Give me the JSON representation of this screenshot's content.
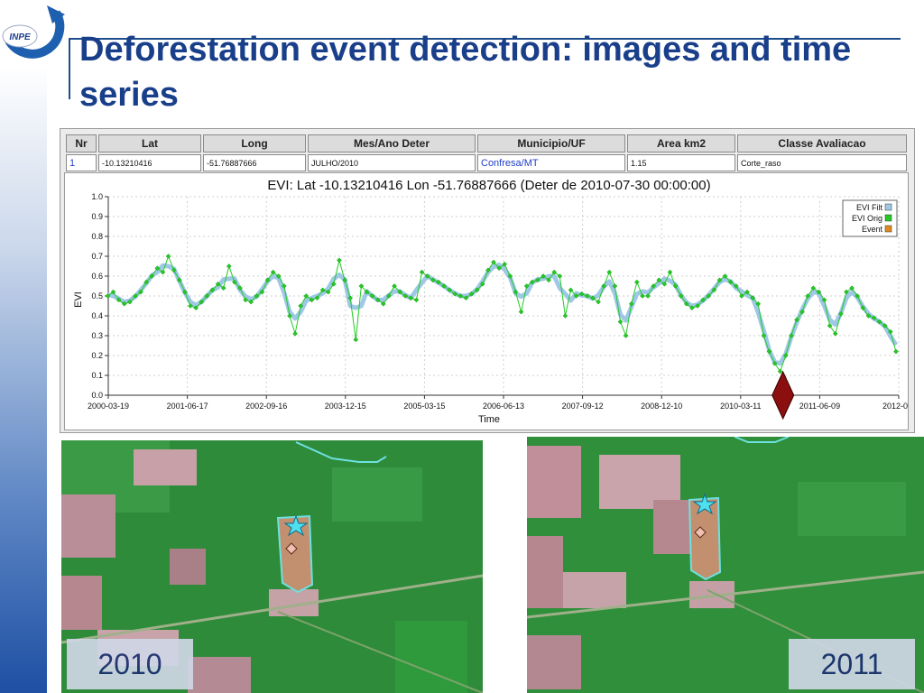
{
  "slide": {
    "title": "Deforestation event detection: images and time series",
    "logo_text": "INPE"
  },
  "table": {
    "headers": [
      "Nr",
      "Lat",
      "Long",
      "Mes/Ano Deter",
      "Municipio/UF",
      "Area km2",
      "Classe Avaliacao"
    ],
    "row": [
      "1",
      "-10.13210416",
      "-51.76887666",
      "JULHO/2010",
      "Confresa/MT",
      "1.15",
      "Corte_raso"
    ]
  },
  "chart_data": {
    "type": "line",
    "title": "EVI: Lat -10.13210416 Lon -51.76887666 (Deter de 2010-07-30 00:00:00)",
    "xlabel": "Time",
    "ylabel": "EVI",
    "ylim": [
      0,
      1
    ],
    "yticks": [
      "0.0",
      "0.1",
      "0.2",
      "0.3",
      "0.4",
      "0.5",
      "0.6",
      "0.7",
      "0.8",
      "0.9",
      "1.0"
    ],
    "xticks": [
      "2000-03-19",
      "2001-06-17",
      "2002-09-16",
      "2003-12-15",
      "2005-03-15",
      "2006-06-13",
      "2007-09-12",
      "2008-12-10",
      "2010-03-11",
      "2011-06-09",
      "2012-09-"
    ],
    "legend": [
      "EVI Filt",
      "EVI Orig",
      "Event"
    ],
    "legend_position": "top-right",
    "grid": true,
    "colors": {
      "filt": "#9ec8e6",
      "orig": "#22cc22",
      "event": "#e08a1e",
      "marker": "#8b0f0f"
    },
    "event_date": "2010-07-30",
    "series": [
      {
        "name": "EVI Orig",
        "values": [
          [
            2000.2,
            0.5
          ],
          [
            2000.3,
            0.52
          ],
          [
            2000.4,
            0.48
          ],
          [
            2000.5,
            0.46
          ],
          [
            2000.6,
            0.47
          ],
          [
            2000.7,
            0.5
          ],
          [
            2000.8,
            0.52
          ],
          [
            2000.9,
            0.57
          ],
          [
            2001.0,
            0.6
          ],
          [
            2001.1,
            0.64
          ],
          [
            2001.2,
            0.62
          ],
          [
            2001.3,
            0.7
          ],
          [
            2001.4,
            0.63
          ],
          [
            2001.5,
            0.58
          ],
          [
            2001.6,
            0.52
          ],
          [
            2001.7,
            0.45
          ],
          [
            2001.8,
            0.44
          ],
          [
            2001.9,
            0.47
          ],
          [
            2002.0,
            0.5
          ],
          [
            2002.1,
            0.53
          ],
          [
            2002.2,
            0.56
          ],
          [
            2002.3,
            0.54
          ],
          [
            2002.4,
            0.65
          ],
          [
            2002.5,
            0.57
          ],
          [
            2002.6,
            0.54
          ],
          [
            2002.7,
            0.48
          ],
          [
            2002.8,
            0.47
          ],
          [
            2002.9,
            0.5
          ],
          [
            2003.0,
            0.52
          ],
          [
            2003.1,
            0.58
          ],
          [
            2003.2,
            0.62
          ],
          [
            2003.3,
            0.6
          ],
          [
            2003.4,
            0.55
          ],
          [
            2003.5,
            0.4
          ],
          [
            2003.6,
            0.31
          ],
          [
            2003.7,
            0.45
          ],
          [
            2003.8,
            0.5
          ],
          [
            2003.9,
            0.48
          ],
          [
            2004.0,
            0.49
          ],
          [
            2004.1,
            0.53
          ],
          [
            2004.2,
            0.52
          ],
          [
            2004.3,
            0.56
          ],
          [
            2004.4,
            0.68
          ],
          [
            2004.5,
            0.58
          ],
          [
            2004.6,
            0.49
          ],
          [
            2004.7,
            0.28
          ],
          [
            2004.8,
            0.55
          ],
          [
            2004.9,
            0.52
          ],
          [
            2005.0,
            0.5
          ],
          [
            2005.1,
            0.48
          ],
          [
            2005.2,
            0.46
          ],
          [
            2005.3,
            0.5
          ],
          [
            2005.4,
            0.55
          ],
          [
            2005.5,
            0.52
          ],
          [
            2005.6,
            0.5
          ],
          [
            2005.7,
            0.49
          ],
          [
            2005.8,
            0.48
          ],
          [
            2005.9,
            0.62
          ],
          [
            2006.0,
            0.6
          ],
          [
            2006.1,
            0.58
          ],
          [
            2006.2,
            0.57
          ],
          [
            2006.3,
            0.55
          ],
          [
            2006.4,
            0.53
          ],
          [
            2006.5,
            0.51
          ],
          [
            2006.6,
            0.5
          ],
          [
            2006.7,
            0.49
          ],
          [
            2006.8,
            0.51
          ],
          [
            2006.9,
            0.53
          ],
          [
            2007.0,
            0.56
          ],
          [
            2007.1,
            0.63
          ],
          [
            2007.2,
            0.67
          ],
          [
            2007.3,
            0.64
          ],
          [
            2007.4,
            0.66
          ],
          [
            2007.5,
            0.6
          ],
          [
            2007.6,
            0.52
          ],
          [
            2007.7,
            0.42
          ],
          [
            2007.8,
            0.55
          ],
          [
            2007.9,
            0.57
          ],
          [
            2008.0,
            0.58
          ],
          [
            2008.1,
            0.6
          ],
          [
            2008.2,
            0.58
          ],
          [
            2008.3,
            0.62
          ],
          [
            2008.4,
            0.6
          ],
          [
            2008.5,
            0.4
          ],
          [
            2008.6,
            0.53
          ],
          [
            2008.7,
            0.5
          ],
          [
            2008.8,
            0.51
          ],
          [
            2008.9,
            0.5
          ],
          [
            2009.0,
            0.49
          ],
          [
            2009.1,
            0.47
          ],
          [
            2009.2,
            0.55
          ],
          [
            2009.3,
            0.62
          ],
          [
            2009.4,
            0.55
          ],
          [
            2009.5,
            0.37
          ],
          [
            2009.6,
            0.3
          ],
          [
            2009.7,
            0.46
          ],
          [
            2009.8,
            0.57
          ],
          [
            2009.9,
            0.5
          ],
          [
            2010.0,
            0.5
          ],
          [
            2010.1,
            0.55
          ],
          [
            2010.2,
            0.58
          ],
          [
            2010.3,
            0.56
          ],
          [
            2010.4,
            0.62
          ],
          [
            2010.5,
            0.55
          ],
          [
            2010.6,
            0.5
          ],
          [
            2010.7,
            0.46
          ],
          [
            2010.8,
            0.44
          ],
          [
            2010.9,
            0.45
          ],
          [
            2011.0,
            0.48
          ],
          [
            2011.1,
            0.5
          ],
          [
            2011.2,
            0.53
          ],
          [
            2011.3,
            0.58
          ],
          [
            2011.4,
            0.6
          ],
          [
            2011.5,
            0.57
          ],
          [
            2011.6,
            0.55
          ],
          [
            2011.7,
            0.5
          ],
          [
            2011.8,
            0.52
          ],
          [
            2011.9,
            0.49
          ],
          [
            2012.0,
            0.46
          ],
          [
            2012.1,
            0.3
          ],
          [
            2012.2,
            0.22
          ],
          [
            2012.3,
            0.16
          ],
          [
            2012.4,
            0.12
          ],
          [
            2012.5,
            0.2
          ],
          [
            2012.6,
            0.3
          ],
          [
            2012.7,
            0.38
          ],
          [
            2012.8,
            0.42
          ],
          [
            2012.9,
            0.5
          ],
          [
            2013.0,
            0.54
          ],
          [
            2013.1,
            0.52
          ],
          [
            2013.2,
            0.48
          ],
          [
            2013.3,
            0.35
          ],
          [
            2013.4,
            0.31
          ],
          [
            2013.5,
            0.41
          ],
          [
            2013.6,
            0.52
          ],
          [
            2013.7,
            0.54
          ],
          [
            2013.8,
            0.5
          ],
          [
            2013.9,
            0.44
          ],
          [
            2014.0,
            0.4
          ],
          [
            2014.1,
            0.39
          ],
          [
            2014.2,
            0.37
          ],
          [
            2014.3,
            0.35
          ],
          [
            2014.4,
            0.32
          ],
          [
            2014.5,
            0.22
          ]
        ]
      }
    ]
  },
  "images": {
    "left_year": "2010",
    "right_year": "2011"
  }
}
